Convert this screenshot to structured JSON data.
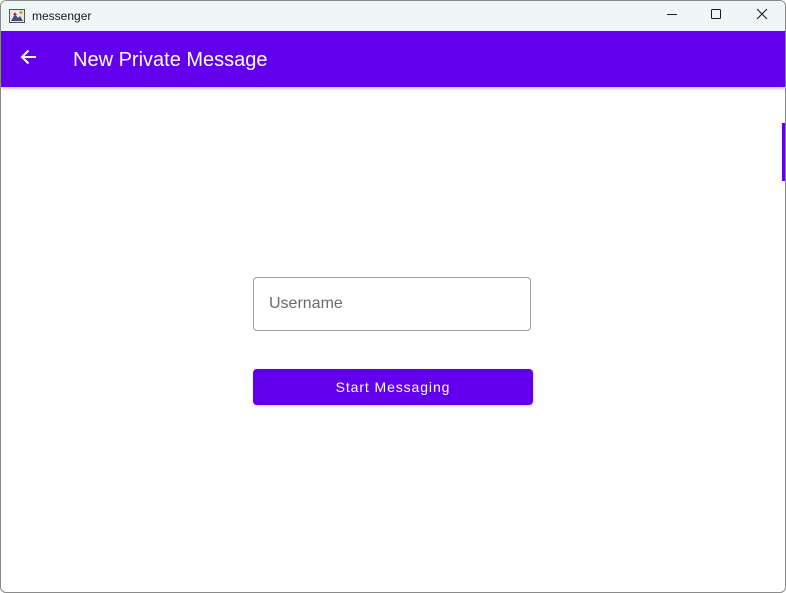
{
  "window": {
    "title": "messenger",
    "icon": "java-app-icon",
    "controls": {
      "minimize_icon": "minimize-icon",
      "maximize_icon": "maximize-icon",
      "close_icon": "close-icon"
    }
  },
  "appbar": {
    "back_icon": "arrow-left-icon",
    "title": "New Private Message",
    "color": "#6200ee"
  },
  "form": {
    "username": {
      "placeholder": "Username",
      "value": ""
    },
    "start_button_label": "Start Messaging"
  },
  "colors": {
    "primary": "#6200ee",
    "titlebar_bg": "#eef6f8",
    "on_primary": "#ffffff"
  }
}
